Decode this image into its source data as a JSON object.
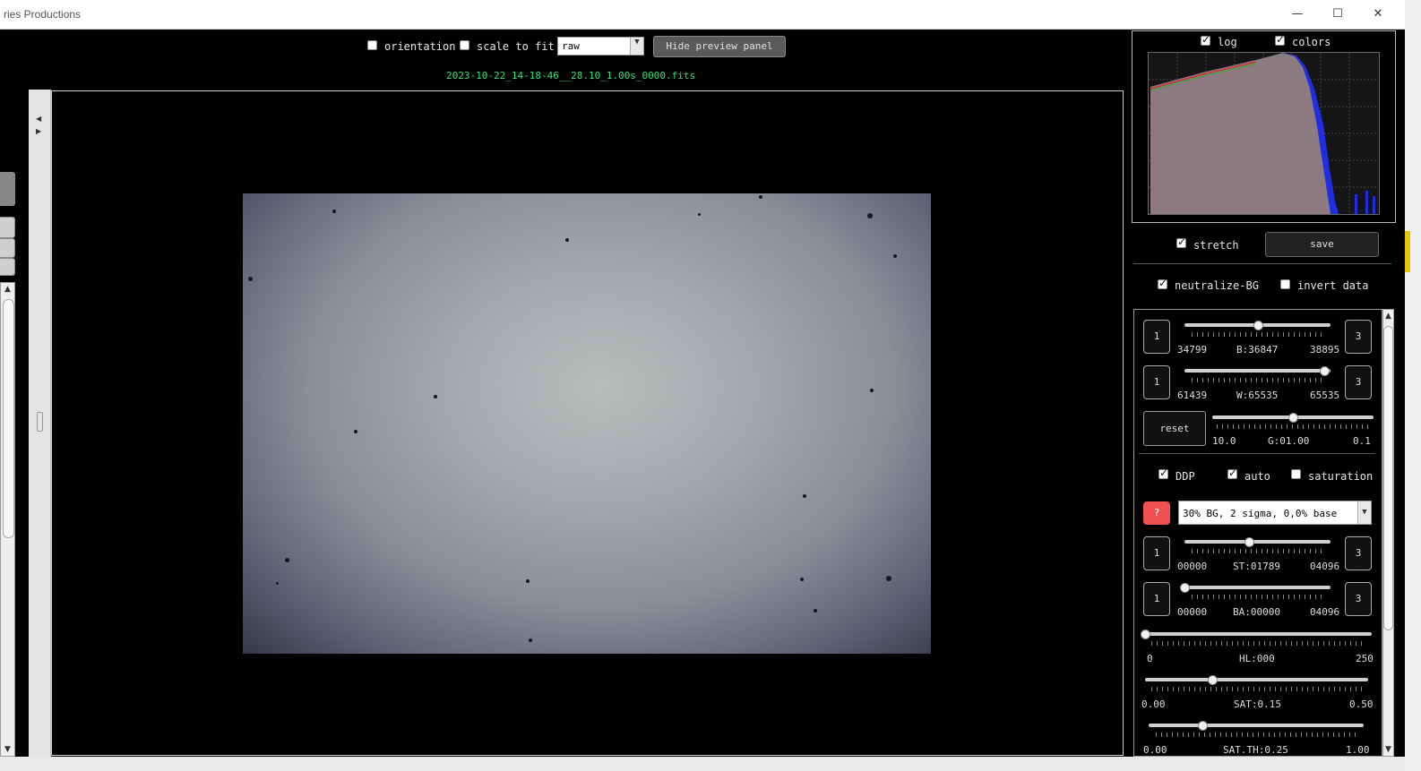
{
  "window": {
    "title": "ries Productions",
    "minimize_glyph": "—",
    "maximize_glyph": "☐",
    "close_glyph": "✕"
  },
  "toolbar": {
    "orientation_label": "orientation",
    "orientation_checked": false,
    "scale_to_fit_label": "scale to fit",
    "scale_to_fit_checked": false,
    "mode_select_value": "raw",
    "hide_preview_label": "Hide preview panel"
  },
  "preview": {
    "filename": "2023-10-22_14-18-46__28.10_1.00s_0000.fits"
  },
  "histogram": {
    "log_label": "log",
    "log_checked": true,
    "colors_label": "colors",
    "colors_checked": true
  },
  "right_panel": {
    "stretch_label": "stretch",
    "stretch_checked": true,
    "save_label": "save",
    "neutralize_bg_label": "neutralize-BG",
    "neutralize_bg_checked": true,
    "invert_data_label": "invert data",
    "invert_data_checked": false,
    "black": {
      "btn_left": "1",
      "btn_right": "3",
      "min": "34799",
      "value_label": "B:36847",
      "max": "38895",
      "position": 0.5
    },
    "white": {
      "btn_left": "1",
      "btn_right": "3",
      "min": "61439",
      "value_label": "W:65535",
      "max": "65535",
      "position": 0.96
    },
    "gamma": {
      "reset_label": "reset",
      "min": "10.0",
      "value_label": "G:01.00",
      "max": "0.1",
      "position": 0.5
    },
    "ddp_label": "DDP",
    "ddp_checked": true,
    "auto_label": "auto",
    "auto_checked": true,
    "saturation_label": "saturation",
    "saturation_checked": false,
    "help_label": "?",
    "preset_value": "30% BG, 2 sigma, 0,0% base",
    "st": {
      "btn_left": "1",
      "btn_right": "3",
      "min": "00000",
      "value_label": "ST:01789",
      "max": "04096",
      "position": 0.44
    },
    "ba": {
      "btn_left": "1",
      "btn_right": "3",
      "min": "00000",
      "value_label": "BA:00000",
      "max": "04096",
      "position": 0.0
    },
    "hl": {
      "min": "0",
      "value_label": "HL:000",
      "max": "250",
      "position": 0.0
    },
    "sat": {
      "min": "0.00",
      "value_label": "SAT:0.15",
      "max": "0.50",
      "position": 0.3
    },
    "sat_th": {
      "min": "0.00",
      "value_label": "SAT.TH:0.25",
      "max": "1.00",
      "position": 0.25
    }
  }
}
